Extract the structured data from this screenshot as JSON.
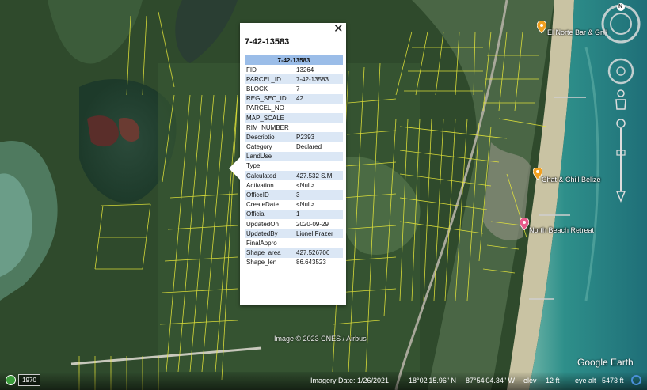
{
  "places": [
    "El Norte Bar & Grill",
    "Chat & Chill Belize",
    "North Beach Retreat"
  ],
  "popup": {
    "title": "7-42-13583",
    "table_header": "7-42-13583",
    "close_symbol": "✕",
    "rows": [
      {
        "key": "FID",
        "value": "13264"
      },
      {
        "key": "PARCEL_ID",
        "value": "7-42-13583"
      },
      {
        "key": "BLOCK",
        "value": "7"
      },
      {
        "key": "REG_SEC_ID",
        "value": "42"
      },
      {
        "key": "PARCEL_NO",
        "value": ""
      },
      {
        "key": "MAP_SCALE",
        "value": ""
      },
      {
        "key": "RIM_NUMBER",
        "value": ""
      },
      {
        "key": "Descriptio",
        "value": "P2393"
      },
      {
        "key": "Category",
        "value": "Declared"
      },
      {
        "key": "LandUse",
        "value": ""
      },
      {
        "key": "Type",
        "value": ""
      },
      {
        "key": "Calculated",
        "value": "427.532 S.M."
      },
      {
        "key": "Activation",
        "value": "<Null>"
      },
      {
        "key": "OfficeID",
        "value": "3"
      },
      {
        "key": "CreateDate",
        "value": "<Null>"
      },
      {
        "key": "Official",
        "value": "1"
      },
      {
        "key": "UpdatedOn",
        "value": "2020-09-29"
      },
      {
        "key": "UpdatedBy",
        "value": "Lionel Frazer"
      },
      {
        "key": "FinalAppro",
        "value": ""
      },
      {
        "key": "Shape_area",
        "value": "427.526706"
      },
      {
        "key": "Shape_len",
        "value": "86.643523"
      }
    ]
  },
  "map_credit": "Image © 2023 CNES / Airbus",
  "brand": "Google Earth",
  "compass_label": "N",
  "status": {
    "year": "1970",
    "imagery_date": "Imagery Date: 1/26/2021",
    "lat": "18°02'15.96\" N",
    "lon": "87°54'04.34\" W",
    "elev_label": "elev",
    "elev_value": "12 ft",
    "eye_alt_label": "eye alt",
    "eye_alt_value": "5473 ft"
  },
  "colors": {
    "parcel_lines": "#e8e83a",
    "header_blue": "#9bbde8",
    "row_alt": "#dbe7f5",
    "water": "#2a8c88",
    "pin_orange": "#f0a020",
    "pin_pink": "#e85a8a"
  },
  "icons": [
    "compass-icon",
    "look-joystick-icon",
    "move-joystick-icon",
    "pegman-icon",
    "zoom-slider-icon",
    "map-pin-icon",
    "close-icon",
    "historical-imagery-icon",
    "streaming-ring-icon"
  ]
}
